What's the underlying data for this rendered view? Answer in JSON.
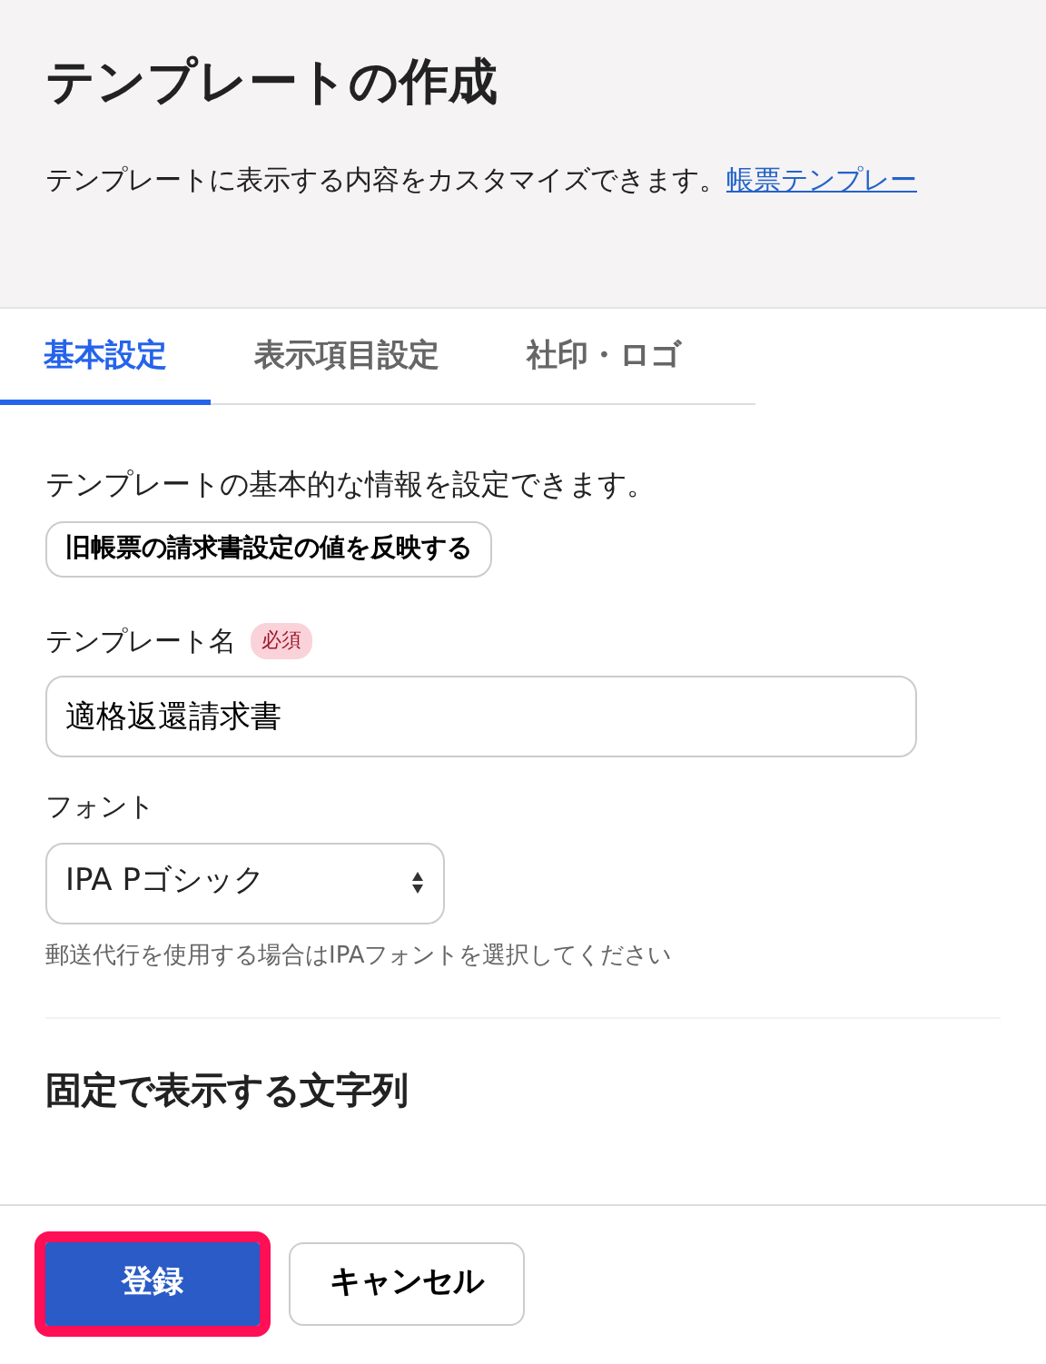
{
  "header": {
    "title": "テンプレートの作成",
    "description": "テンプレートに表示する内容をカスタマイズできます。",
    "link": "帳票テンプレー"
  },
  "tabs": [
    {
      "label": "基本設定",
      "selected": true
    },
    {
      "label": "表示項目設定",
      "selected": false
    },
    {
      "label": "社印・ロゴ",
      "selected": false
    }
  ],
  "intro": "テンプレートの基本的な情報を設定できます。",
  "apply_button": "旧帳票の請求書設定の値を反映する",
  "template_name": {
    "label": "テンプレート名",
    "badge": "必須",
    "value": "適格返還請求書"
  },
  "font": {
    "label": "フォント",
    "value": "IPA Pゴシック",
    "help": "郵送代行を使用する場合はIPAフォントを選択してください"
  },
  "section_title": "固定で表示する文字列",
  "footer_buttons": [
    {
      "label": "登録",
      "kind": "primary",
      "highlighted": true
    },
    {
      "label": "キャンセル",
      "kind": "secondary",
      "highlighted": false
    }
  ]
}
